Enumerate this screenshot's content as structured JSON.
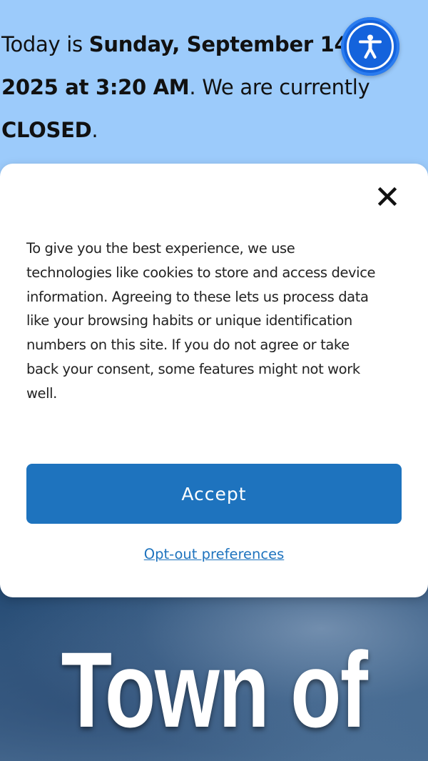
{
  "status": {
    "prefix": "Today is ",
    "date": "Sunday, September 14",
    "separator": ", ",
    "time": "2025 at 3:20 AM",
    "middle": ". We are currently ",
    "state": "CLOSED",
    "suffix": "."
  },
  "accessibility": {
    "icon": "accessibility-person-icon"
  },
  "consent": {
    "close_icon": "close-x-icon",
    "message": "To give you the best experience, we use technologies like cookies to store and access device information. Agreeing to these lets us process data like your browsing habits or unique identification numbers on this site. If you do not agree or take back your consent, some features might not work well.",
    "accept_label": "Accept",
    "optout_label": "Opt-out preferences"
  },
  "hero": {
    "title": "Town of"
  },
  "colors": {
    "banner_bg": "#9ccbfb",
    "accent": "#1e73be",
    "a11y_blue": "#1463dc"
  }
}
